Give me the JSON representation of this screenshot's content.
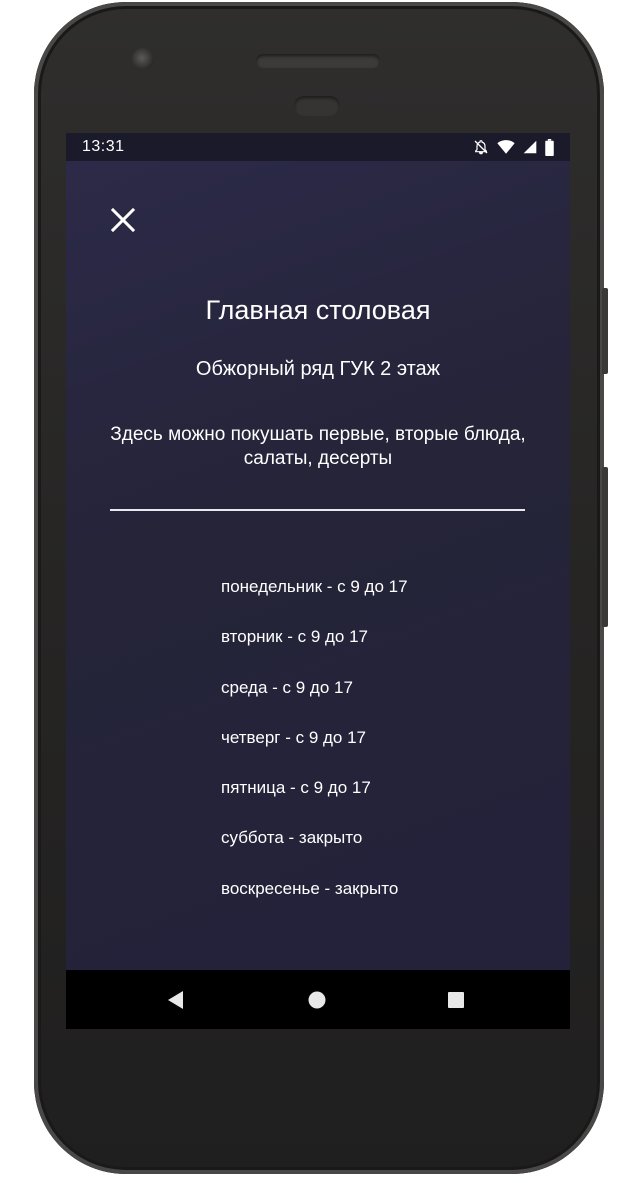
{
  "status_bar": {
    "time": "13:31",
    "icons": [
      "notifications-off-icon",
      "wifi-icon",
      "signal-icon",
      "battery-icon"
    ]
  },
  "header": {
    "close_icon": "close-icon"
  },
  "cafeteria": {
    "title": "Главная столовая",
    "location": "Обжорный ряд ГУК 2 этаж",
    "description": "Здесь можно покушать первые, вторые блюда, салаты, десерты"
  },
  "schedule": [
    "понедельник - с 9 до 17",
    "вторник - с 9 до 17",
    "среда - с 9 до 17",
    "четверг - с 9 до 17",
    "пятница - с 9 до 17",
    "суббота - закрыто",
    "воскресенье - закрыто"
  ],
  "nav_bar": {
    "icons": [
      "back-icon",
      "home-icon",
      "recents-icon"
    ]
  },
  "colors": {
    "background": "#23223a",
    "background_accent": "#2c2a48",
    "status_bar": "#1b1a2b",
    "text": "#ffffff",
    "nav_bar": "#000000"
  }
}
